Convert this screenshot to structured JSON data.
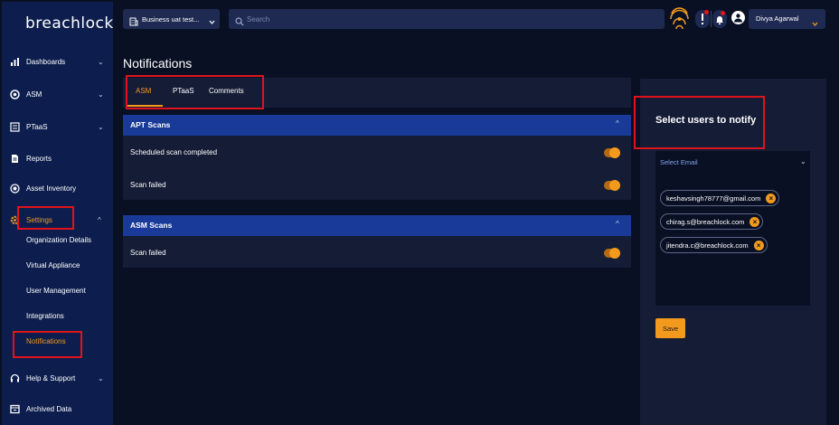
{
  "brand": {
    "logo": "breachlock"
  },
  "colors": {
    "accent": "#f39a1e",
    "sidebar_bg": "#0d1e4e",
    "card_header": "#1a3a9a",
    "highlight": "#e0131c"
  },
  "sidebar": {
    "items": [
      {
        "label": "Dashboards",
        "icon": "bar-chart-icon",
        "chevron": "⌄"
      },
      {
        "label": "ASM",
        "icon": "target-icon",
        "chevron": "⌄"
      },
      {
        "label": "PTaaS",
        "icon": "list-icon",
        "chevron": "⌄"
      },
      {
        "label": "Reports",
        "icon": "document-icon"
      },
      {
        "label": "Asset Inventory",
        "icon": "radar-icon"
      },
      {
        "label": "Settings",
        "icon": "gear-icon",
        "chevron": "^"
      },
      {
        "label": "Help & Support",
        "icon": "headset-icon",
        "chevron": "⌄"
      },
      {
        "label": "Archived Data",
        "icon": "archive-icon"
      }
    ],
    "settings_sub": [
      {
        "label": "Organization Details"
      },
      {
        "label": "Virtual Appliance"
      },
      {
        "label": "User Management"
      },
      {
        "label": "Integrations"
      },
      {
        "label": "Notifications"
      }
    ]
  },
  "topbar": {
    "business_select": "Business uat test...",
    "search_placeholder": "Search",
    "user_name": "Divya Agarwal",
    "user_chevron": "⌄"
  },
  "main": {
    "title": "Notifications",
    "tabs": [
      {
        "label": "ASM",
        "active": true
      },
      {
        "label": "PTaaS"
      },
      {
        "label": "Comments"
      }
    ],
    "sections": [
      {
        "title": "APT Scans",
        "caret": "^",
        "rows": [
          {
            "label": "Scheduled scan completed",
            "enabled": true
          },
          {
            "label": "Scan failed",
            "enabled": true
          }
        ]
      },
      {
        "title": "ASM Scans",
        "caret": "^",
        "rows": [
          {
            "label": "Scan failed",
            "enabled": true
          }
        ]
      }
    ]
  },
  "notify": {
    "title": "Select users to notify",
    "select_placeholder": "Select Email",
    "select_chevron": "⌄",
    "emails": [
      {
        "address": "keshavsingh78777@gmail.com",
        "remove": "×"
      },
      {
        "address": "chirag.s@breachlock.com",
        "remove": "×"
      },
      {
        "address": "jitendra.c@breachlock.com",
        "remove": "×"
      }
    ],
    "save_label": "Save"
  }
}
